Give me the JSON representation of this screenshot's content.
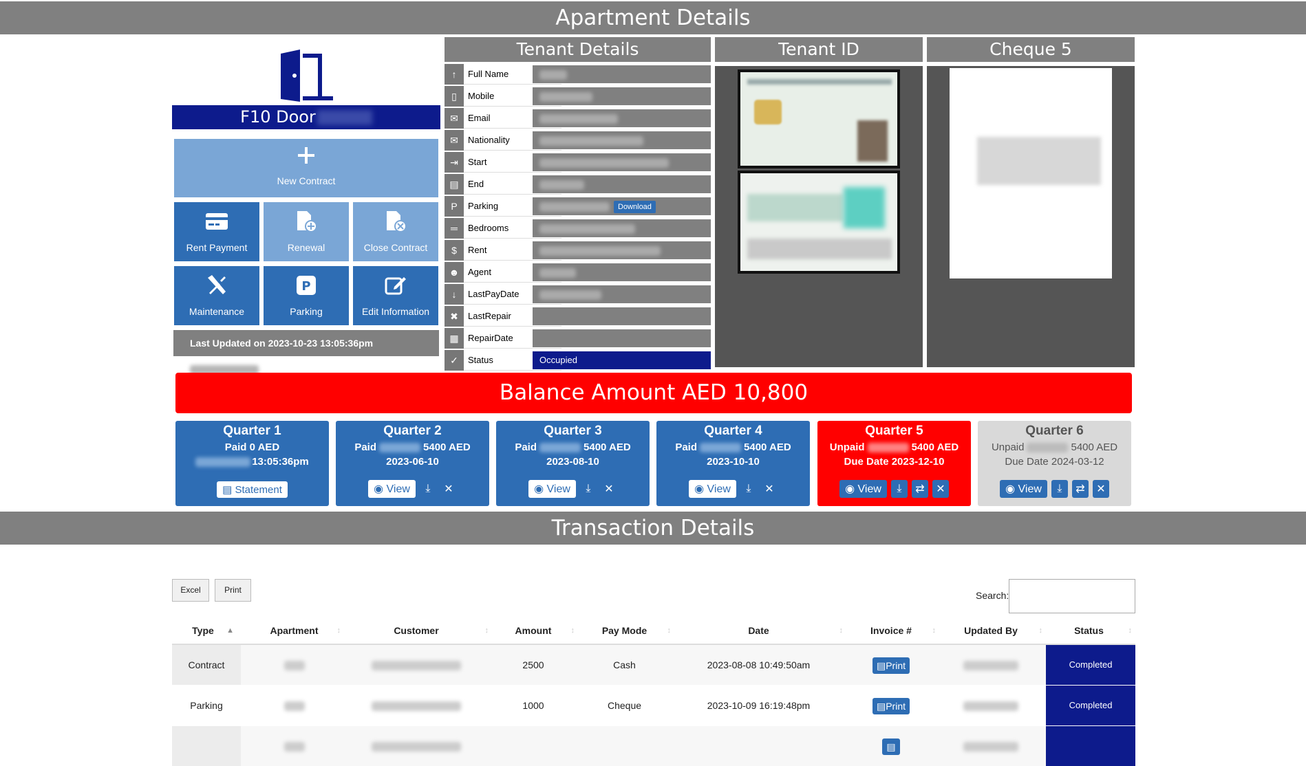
{
  "header": {
    "title": "Apartment Details"
  },
  "unit": {
    "title": "F10 Door"
  },
  "actions": {
    "new_contract": "New Contract",
    "rent_payment": "Rent Payment",
    "renewal": "Renewal",
    "close_contract": "Close Contract",
    "maintenance": "Maintenance",
    "parking": "Parking",
    "edit_information": "Edit Information"
  },
  "last_updated": {
    "prefix": "Last Updated on",
    "datetime": "2023-10-23 13:05:36pm"
  },
  "tenant": {
    "title": "Tenant Details",
    "fields": [
      {
        "label": "Full Name",
        "icon": "user-icon"
      },
      {
        "label": "Mobile",
        "icon": "mobile-icon"
      },
      {
        "label": "Email",
        "icon": "envelope-icon"
      },
      {
        "label": "Nationality",
        "icon": "envelope-icon"
      },
      {
        "label": "Start",
        "icon": "calendar-in-icon"
      },
      {
        "label": "End",
        "icon": "document-icon"
      },
      {
        "label": "Parking",
        "icon": "parking-icon"
      },
      {
        "label": "Bedrooms",
        "icon": "bed-icon"
      },
      {
        "label": "Rent",
        "icon": "money-icon"
      },
      {
        "label": "Agent",
        "icon": "agent-icon"
      },
      {
        "label": "LastPayDate",
        "icon": "hand-money-icon"
      },
      {
        "label": "LastRepair",
        "icon": "tools-icon"
      },
      {
        "label": "RepairDate",
        "icon": "calendar-icon"
      },
      {
        "label": "Status",
        "icon": "check-icon"
      }
    ],
    "parking_download": "Download",
    "status_value": "Occupied"
  },
  "tenant_id": {
    "title": "Tenant ID"
  },
  "cheque": {
    "title": "Cheque 5"
  },
  "balance": {
    "text": "Balance Amount AED 10,800"
  },
  "quarters": [
    {
      "title": "Quarter 1",
      "line1": "Paid 0 AED",
      "line2": "13:05:36pm",
      "button": "Statement",
      "state": "paid"
    },
    {
      "title": "Quarter 2",
      "line1_prefix": "Paid",
      "line1_suffix": "5400 AED",
      "line2": "2023-06-10",
      "view": "View",
      "state": "paid"
    },
    {
      "title": "Quarter 3",
      "line1_prefix": "Paid",
      "line1_suffix": "5400 AED",
      "line2": "2023-08-10",
      "view": "View",
      "state": "paid"
    },
    {
      "title": "Quarter 4",
      "line1_prefix": "Paid",
      "line1_suffix": "5400 AED",
      "line2": "2023-10-10",
      "view": "View",
      "state": "paid"
    },
    {
      "title": "Quarter 5",
      "line1_prefix": "Unpaid",
      "line1_suffix": "5400 AED",
      "line2": "Due Date 2023-12-10",
      "view": "View",
      "state": "unpaid"
    },
    {
      "title": "Quarter 6",
      "line1_prefix": "Unpaid",
      "line1_suffix": "5400 AED",
      "line2": "Due Date 2024-03-12",
      "view": "View",
      "state": "future"
    }
  ],
  "transactions": {
    "title": "Transaction Details",
    "excel": "Excel",
    "print": "Print",
    "search_label": "Search:",
    "columns": [
      "Type",
      "Apartment",
      "Customer",
      "Amount",
      "Pay Mode",
      "Date",
      "Invoice #",
      "Updated By",
      "Status"
    ],
    "rows": [
      {
        "type": "Contract",
        "amount": "2500",
        "pay_mode": "Cash",
        "date": "2023-08-08 10:49:50am",
        "invoice": "Print",
        "status": "Completed"
      },
      {
        "type": "Parking",
        "amount": "1000",
        "pay_mode": "Cheque",
        "date": "2023-10-09 16:19:48pm",
        "invoice": "Print",
        "status": "Completed"
      }
    ]
  },
  "colors": {
    "navy": "#0d1b8c",
    "blue": "#2e6db4",
    "red": "#ff0000",
    "gray": "#808080"
  }
}
